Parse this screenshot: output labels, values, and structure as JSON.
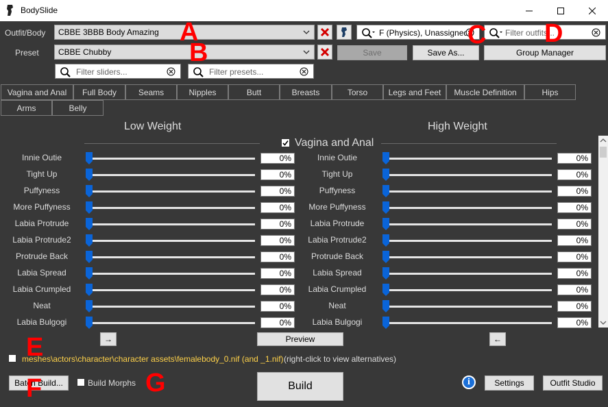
{
  "window": {
    "title": "BodySlide"
  },
  "outfit": {
    "label": "Outfit/Body",
    "value": "CBBE 3BBB Body Amazing"
  },
  "preset": {
    "label": "Preset",
    "value": "CBBE Chubby"
  },
  "group_filter": {
    "value": "F (Physics), Unassigned"
  },
  "outfit_filter": {
    "placeholder": "Filter outfits..."
  },
  "slider_filter": {
    "placeholder": "Filter sliders..."
  },
  "preset_filter": {
    "placeholder": "Filter presets..."
  },
  "buttons": {
    "save": "Save",
    "save_as": "Save As...",
    "group_manager": "Group Manager",
    "preview": "Preview",
    "batch_build": "Batch Build...",
    "build": "Build",
    "settings": "Settings",
    "outfit_studio": "Outfit Studio",
    "build_morphs": "Build Morphs",
    "arrow_right": "→",
    "arrow_left": "←",
    "info": "i"
  },
  "tabs": [
    "Vagina and Anal",
    "Full Body",
    "Seams",
    "Nipples",
    "Butt",
    "Breasts",
    "Torso",
    "Legs and Feet",
    "Muscle Definition",
    "Hips",
    "Arms",
    "Belly"
  ],
  "columns": {
    "low": "Low Weight",
    "high": "High Weight"
  },
  "category": {
    "name": "Vagina and Anal",
    "checked": true
  },
  "sliders": [
    {
      "name": "Innie Outie",
      "low": "0%",
      "high": "0%"
    },
    {
      "name": "Tight Up",
      "low": "0%",
      "high": "0%"
    },
    {
      "name": "Puffyness",
      "low": "0%",
      "high": "0%"
    },
    {
      "name": "More Puffyness",
      "low": "0%",
      "high": "0%"
    },
    {
      "name": "Labia Protrude",
      "low": "0%",
      "high": "0%"
    },
    {
      "name": "Labia Protrude2",
      "low": "0%",
      "high": "0%"
    },
    {
      "name": "Protrude Back",
      "low": "0%",
      "high": "0%"
    },
    {
      "name": "Labia Spread",
      "low": "0%",
      "high": "0%"
    },
    {
      "name": "Labia Crumpled",
      "low": "0%",
      "high": "0%"
    },
    {
      "name": "Neat",
      "low": "0%",
      "high": "0%"
    },
    {
      "name": "Labia Bulgogi",
      "low": "0%",
      "high": "0%"
    }
  ],
  "output": {
    "path": "meshes\\actors\\character\\character assets\\femalebody_0.nif (and _1.nif)",
    "hint": "(right-click to view alternatives)"
  },
  "annotations": [
    "A",
    "B",
    "C",
    "D",
    "E",
    "F",
    "G"
  ],
  "colors": {
    "background": "#383838",
    "accent_blue": "#1a6fd8",
    "annotation_red": "#ff0000",
    "path_yellow": "#ffd24a"
  }
}
